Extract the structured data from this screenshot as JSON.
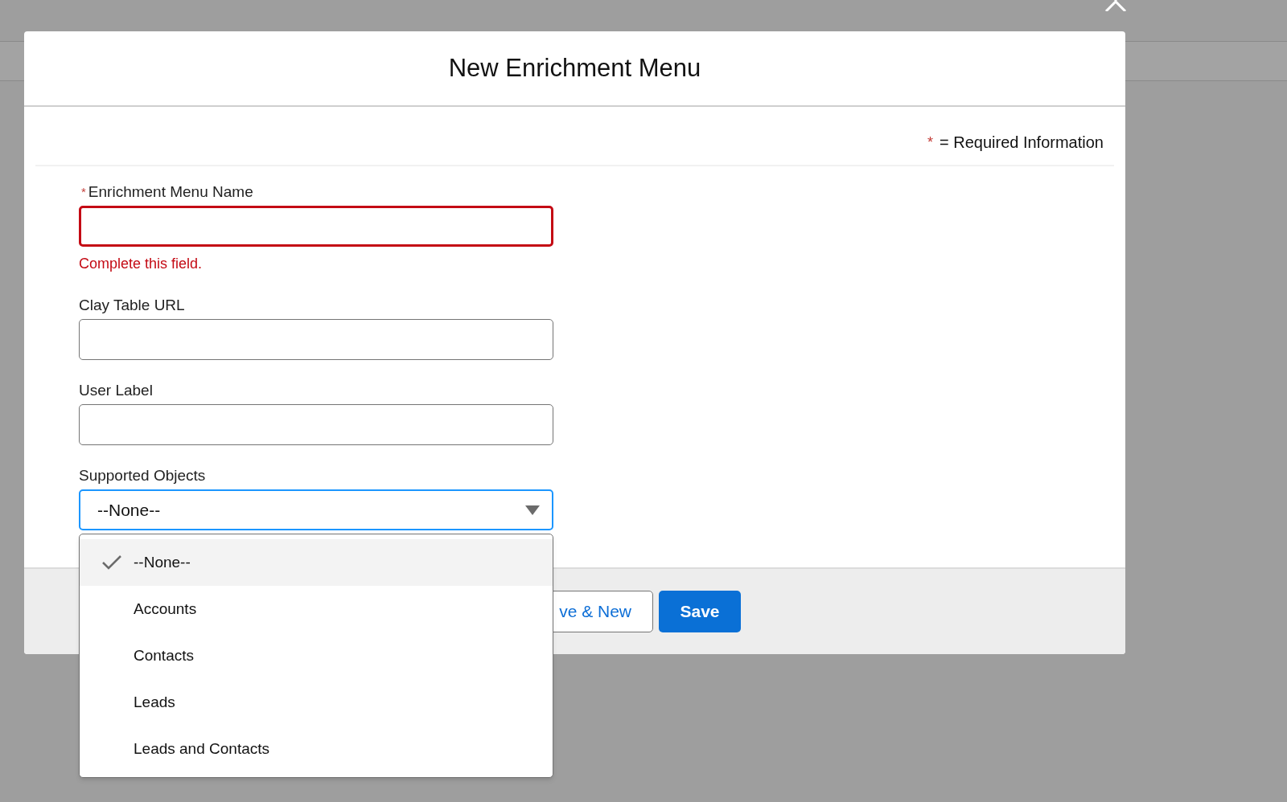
{
  "modal": {
    "title": "New Enrichment Menu",
    "required_note": {
      "mark": "*",
      "text": "= Required Information"
    },
    "fields": [
      {
        "kind": "text",
        "label": "Enrichment Menu Name",
        "required": true,
        "error": "Complete this field."
      },
      {
        "kind": "text",
        "label": "Clay Table URL",
        "required": false
      },
      {
        "kind": "text",
        "label": "User Label",
        "required": false
      },
      {
        "kind": "select",
        "label": "Supported Objects",
        "required": false,
        "value": "--None--",
        "focused": true,
        "expanded": true,
        "options": [
          {
            "label": "--None--",
            "selected": true
          },
          {
            "label": "Accounts",
            "selected": false
          },
          {
            "label": "Contacts",
            "selected": false
          },
          {
            "label": "Leads",
            "selected": false
          },
          {
            "label": "Leads and Contacts",
            "selected": false
          }
        ]
      }
    ],
    "buttons": [
      {
        "kind": "neutral",
        "label": "ve & New"
      },
      {
        "kind": "brand",
        "label": "Save"
      }
    ]
  }
}
